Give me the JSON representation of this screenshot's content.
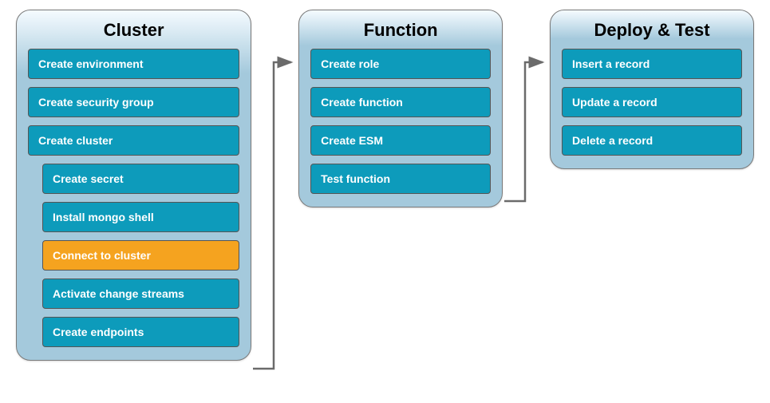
{
  "panels": {
    "cluster": {
      "title": "Cluster",
      "items_top": [
        {
          "label": "Create environment",
          "highlight": false
        },
        {
          "label": "Create security group",
          "highlight": false
        },
        {
          "label": "Create cluster",
          "highlight": false
        }
      ],
      "items_nested": [
        {
          "label": "Create secret",
          "highlight": false
        },
        {
          "label": "Install mongo shell",
          "highlight": false
        },
        {
          "label": "Connect to cluster",
          "highlight": true
        },
        {
          "label": "Activate change streams",
          "highlight": false
        },
        {
          "label": "Create endpoints",
          "highlight": false
        }
      ]
    },
    "function": {
      "title": "Function",
      "items": [
        {
          "label": "Create role",
          "highlight": false
        },
        {
          "label": "Create function",
          "highlight": false
        },
        {
          "label": "Create ESM",
          "highlight": false
        },
        {
          "label": "Test function",
          "highlight": false
        }
      ]
    },
    "deploy": {
      "title": "Deploy & Test",
      "items": [
        {
          "label": "Insert a record",
          "highlight": false
        },
        {
          "label": "Update a record",
          "highlight": false
        },
        {
          "label": "Delete a record",
          "highlight": false
        }
      ]
    }
  },
  "colors": {
    "step": "#0d9bbb",
    "highlight": "#f5a31f",
    "panel_bg": "#a4c9dc",
    "arrow": "#6b6b6b"
  }
}
